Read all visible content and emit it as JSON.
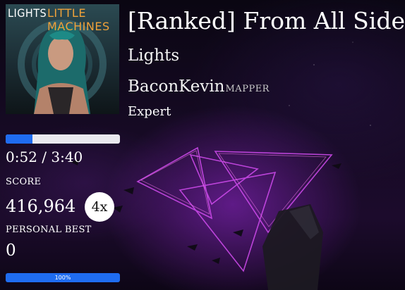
{
  "song": {
    "title": "[Ranked] From All Sides",
    "artist": "Lights",
    "mapper": "BaconKevin",
    "mapper_tag": "MAPPER",
    "difficulty": "Expert"
  },
  "cover": {
    "artist_text": "LIGHTS",
    "album_text": "LITTLE MACHINES"
  },
  "progress": {
    "time": "0:52 / 3:40",
    "fraction": 0.236
  },
  "score": {
    "label": "SCORE",
    "value": "416,964",
    "multiplier": "4x"
  },
  "personal_best": {
    "label": "PERSONAL BEST",
    "value": "0"
  },
  "accuracy": {
    "text": "100%",
    "fraction": 1.0
  },
  "colors": {
    "accent": "#1f6cf0",
    "neon": "#d63cff"
  }
}
